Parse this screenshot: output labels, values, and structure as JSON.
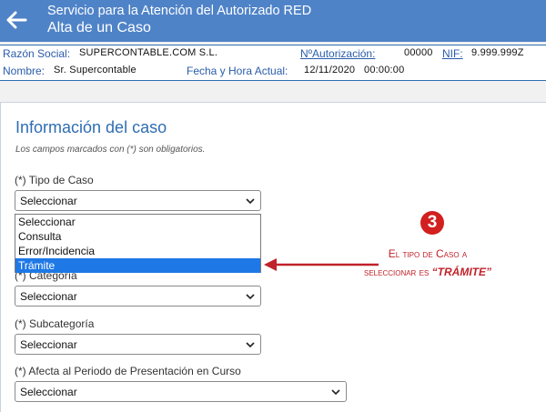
{
  "header": {
    "title_line1": "Servicio para la Atención del Autorizado RED",
    "title_line2": "Alta de un Caso"
  },
  "info": {
    "razon_social_label": "Razón Social:",
    "razon_social_value": "SUPERCONTABLE.COM S.L.",
    "autorizacion_label": "NºAutorización:",
    "autorizacion_value": "00000",
    "nif_label": "NIF:",
    "nif_value": "9.999.999Z",
    "nombre_label": "Nombre:",
    "nombre_value": "Sr. Supercontable",
    "fecha_label": "Fecha y Hora Actual:",
    "fecha_value": "12/11/2020   00:00:00"
  },
  "form": {
    "title": "Información del caso",
    "note": "Los campos marcados con (*) son obligatorios.",
    "tipo_label": "(*) Tipo de Caso",
    "tipo_value": "Seleccionar",
    "tipo_options": [
      "Seleccionar",
      "Consulta",
      "Error/Incidencia",
      "Trámite"
    ],
    "tipo_highlighted": "Trámite",
    "categoria_label": "(*) Categoría",
    "categoria_value": "Seleccionar",
    "subcategoria_label": "(*) Subcategoría",
    "subcategoria_value": "Seleccionar",
    "periodo_label": "(*) Afecta al Periodo de Presentación en Curso",
    "periodo_value": "Seleccionar"
  },
  "annotation": {
    "number": "3",
    "line1": "El tipo de Caso a",
    "line2_prefix": "seleccionar es ",
    "line2_bold": "“TRÁMITE”"
  },
  "colors": {
    "header_bg": "#4f83c8",
    "accent": "#2f6db3",
    "highlight": "#1e78e6",
    "annotation_red": "#c0222a"
  },
  "icons": {
    "back": "arrow-left-icon",
    "chevron": "chevron-down-icon"
  }
}
